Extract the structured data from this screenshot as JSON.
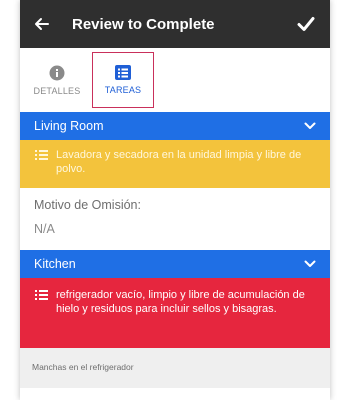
{
  "header": {
    "title": "Review to Complete",
    "back_icon": "arrow-left-icon",
    "confirm_icon": "check-icon"
  },
  "tabs": [
    {
      "label": "DETALLES",
      "icon": "info-icon",
      "active": false
    },
    {
      "label": "TAREAS",
      "icon": "list-icon",
      "active": true
    }
  ],
  "sections": [
    {
      "title": "Living Room",
      "task_text": "Lavadora y secadora en la unidad limpia y libre de polvo.",
      "task_color": "#f3c33c",
      "omission_label": "Motivo de Omisión:",
      "omission_value": "N/A"
    },
    {
      "title": "Kitchen",
      "task_text": "refrigerador vacío, limpio y libre de acumulación de hielo y residuos para incluir sellos y bisagras.",
      "task_color": "#e6263e",
      "note_label": "Manchas en el refrigerador"
    }
  ],
  "colors": {
    "appbar": "#2f2f2f",
    "section_header": "#1f6fe5",
    "active_tab": "#1f5fd6",
    "tab_highlight_border": "#c9305b"
  }
}
